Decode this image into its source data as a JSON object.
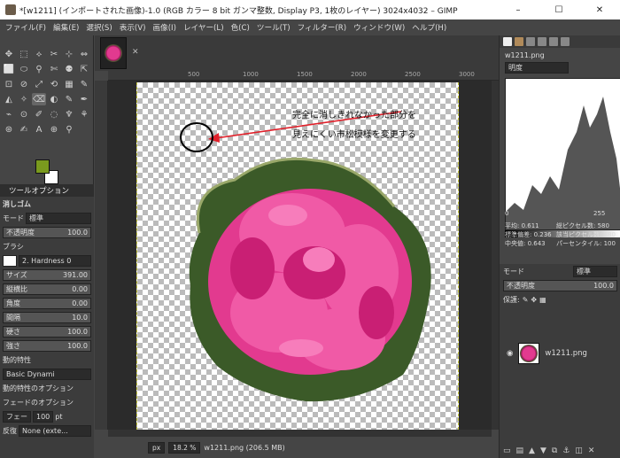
{
  "window": {
    "title": "*[w1211] (インポートされた画像)-1.0 (RGB カラー 8 bit ガンマ整数, Display P3, 1枚のレイヤー) 3024x4032 – GIMP",
    "minimize": "–",
    "maximize": "☐",
    "close": "✕"
  },
  "menu": [
    "ファイル(F)",
    "編集(E)",
    "選択(S)",
    "表示(V)",
    "画像(I)",
    "レイヤー(L)",
    "色(C)",
    "ツール(T)",
    "フィルター(R)",
    "ウィンドウ(W)",
    "ヘルプ(H)"
  ],
  "tools": [
    "✥",
    "⬚",
    "⟡",
    "✂",
    "⊹",
    "⇔",
    "⬜",
    "⬭",
    "⚲",
    "✄",
    "⚉",
    "⇱",
    "⊡",
    "⊘",
    "⤢",
    "⟲",
    "▦",
    "✎",
    "◭",
    "✧",
    "⌫",
    "◐",
    "✎",
    "✒",
    "⌁",
    "⊙",
    "✐",
    "◌",
    "♆",
    "⚘",
    "⊛",
    "✍",
    "A",
    "⊕",
    "⚲"
  ],
  "tool_options": {
    "tab": "ツールオプション",
    "title": "消しゴム",
    "mode_label": "モード",
    "mode": "標準",
    "opacity_label": "不透明度",
    "opacity": "100.0",
    "brush_label": "ブラシ",
    "brush": "2. Hardness 0",
    "size_label": "サイズ",
    "size": "391.00",
    "aspect_label": "縦横比",
    "aspect": "0.00",
    "angle_label": "角度",
    "angle": "0.00",
    "spacing_label": "間隔",
    "spacing": "10.0",
    "hardness_label": "硬さ",
    "hardness": "100.0",
    "force_label": "強さ",
    "force": "100.0",
    "dynamics_label": "動的特性",
    "dynamics": "Basic Dynami",
    "dyn_options": "動的特性のオプション",
    "fade_options": "フェードのオプション",
    "fade_label": "フェー",
    "fade_value": "100",
    "fade_unit": "pt",
    "repeat_label": "反復",
    "repeat_value": "None (exte..."
  },
  "ruler_marks": [
    "500",
    "1000",
    "1500",
    "2000",
    "2500",
    "3000"
  ],
  "annotation": {
    "line1": "完全に消しきれなかった部分を",
    "line2": "見えにくい市松模様を変更する"
  },
  "status": {
    "unit": "px",
    "zoom": "18.2 %",
    "file": "w1211.png (206.5 MB)"
  },
  "histogram": {
    "filename": "w1211.png",
    "channel": "明度",
    "low": "0",
    "high": "255",
    "mean_label": "平均:",
    "mean": "0.611",
    "std_label": "標準偏差:",
    "std": "0.236",
    "median_label": "中央値:",
    "median": "0.643",
    "pixels_label": "総ピクセル数:",
    "pixels": "580",
    "count_label": "該当ピクセル数:",
    "count": "580",
    "pct_label": "パーセンタイル:",
    "pct": "100"
  },
  "layers": {
    "mode_label": "モード",
    "mode": "標準",
    "opacity_label": "不透明度",
    "opacity": "100.0",
    "lock_label": "保護:",
    "layer_name": "w1211.png"
  },
  "colors": {
    "fg": "#7a9a1e",
    "bg": "#ffffff",
    "arrow": "#e0202a",
    "rose": "#e23a8f"
  }
}
